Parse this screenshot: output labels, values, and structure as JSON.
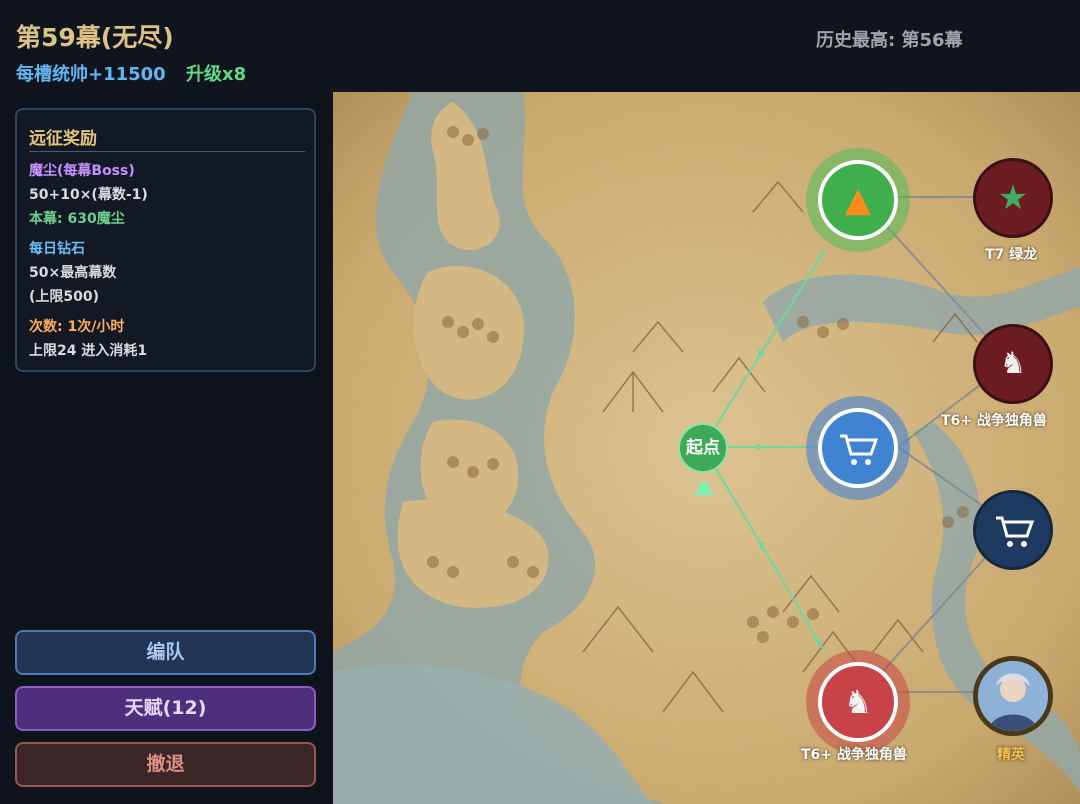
{
  "header": {
    "stage_title": "第59幕(无尽)",
    "slot_bonus": "每槽统帅+11500",
    "upgrade": "升级x8",
    "best_record": "历史最高: 第56幕"
  },
  "reward_panel": {
    "title": "远征奖励",
    "dust_header": "魔尘(每幕Boss)",
    "dust_formula": "50+10×(幕数-1)",
    "dust_current": "本幕: 630魔尘",
    "diamond_header": "每日钻石",
    "diamond_formula": "50×最高幕数",
    "diamond_cap": "(上限500)",
    "attempts": "次数: 1次/小时",
    "attempts_note": "上限24 进入消耗1"
  },
  "buttons": {
    "team": "编队",
    "talent": "天赋(12)",
    "retreat": "撤退"
  },
  "map": {
    "start_label": "起点",
    "nodes": [
      {
        "id": "campfire",
        "icon": "fire-icon",
        "color": "#3daa4a"
      },
      {
        "id": "shop",
        "icon": "cart-icon",
        "color": "#3f83d2"
      },
      {
        "id": "unicorn-main",
        "icon": "unicorn-icon",
        "label": "T6+ 战争独角兽",
        "color": "#c84348"
      },
      {
        "id": "green-dragon",
        "icon": "dragon-icon",
        "label": "T7 绿龙",
        "color": "#6b1d22"
      },
      {
        "id": "unicorn-right",
        "icon": "unicorn-icon",
        "label": "T6+ 战争独角兽",
        "color": "#6b1d22"
      },
      {
        "id": "shop-right",
        "icon": "cart-icon",
        "color": "#1f3a60"
      },
      {
        "id": "elite",
        "icon": "hero-portrait-icon",
        "label": "精英",
        "color": "#5a4520"
      }
    ]
  }
}
